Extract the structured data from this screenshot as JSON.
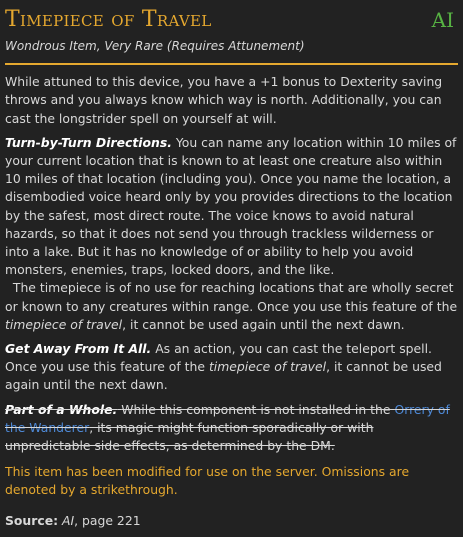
{
  "item": {
    "name": "Timepiece of Travel",
    "source_tag": "AI",
    "subtitle": "Wondrous Item, Very Rare (Requires Attunement)",
    "intro": "While attuned to this device, you have a +1 bonus to Dexterity saving throws and you always know which way is north. Additionally, you can cast the longstrider spell on yourself at will.",
    "entries": [
      {
        "heading": "Turn-by-Turn Directions.",
        "text": "You can name any location within 10 miles of your current location that is known to at least one creature also within 10 miles of that location (including you). Once you name the location, a disembodied voice heard only by you provides directions to the location by the safest, most direct route. The voice knows to avoid natural hazards, so that it does not send you through trackless wilderness or into a lake. But it has no knowledge of or ability to help you avoid monsters, enemies, traps, locked doors, and the like.",
        "cont_pre": "The timepiece is of no use for reaching locations that are wholly secret or known to any creatures within range. Once you use this feature of the ",
        "cont_em": "timepiece of travel",
        "cont_post": ", it cannot be used again until the next dawn."
      },
      {
        "heading": "Get Away From It All.",
        "text_pre": "As an action, you can cast the teleport spell. Once you use this feature of the ",
        "text_em": "timepiece of travel",
        "text_post": ", it cannot be used again until the next dawn."
      },
      {
        "heading": "Part of a Whole.",
        "text_pre": "While this component is not installed in the ",
        "link": "Orrery of the Wanderer",
        "text_post": ", its magic might function sporadically or with unpredictable side effects, as determined by the DM."
      }
    ],
    "notice": "This item has been modified for use on the server. Omissions are denoted by a strikethrough.",
    "source": {
      "label": "Source:",
      "book": "AI",
      "page": ", page 221"
    }
  },
  "colors": {
    "background": "#222222",
    "title": "#e5a82f",
    "source_tag": "#57b343",
    "link": "#4e89d6",
    "text": "#d8d8d8"
  }
}
